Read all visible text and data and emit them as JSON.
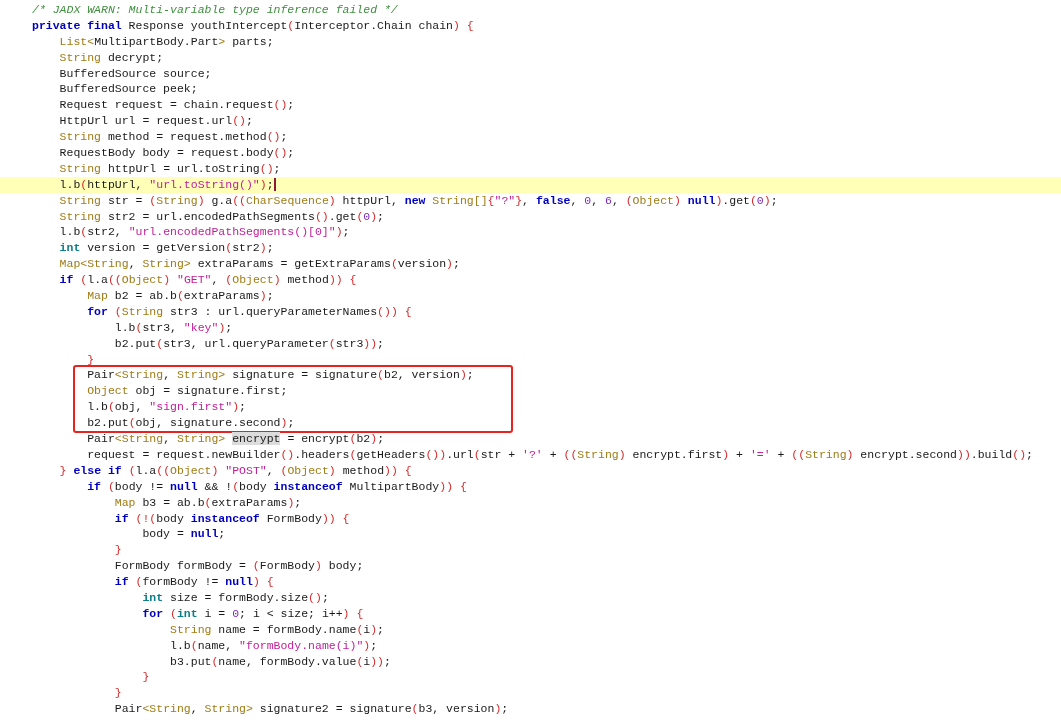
{
  "editor": {
    "blocks": [
      {
        "kind": "plain",
        "lines": [
          {
            "current": false,
            "tokens": [
              {
                "text": "/* JADX WARN: Multi-variable type inference failed */",
                "kind": "comment"
              }
            ]
          },
          {
            "current": false,
            "tokens": [
              {
                "text": "private final",
                "kind": "keyword"
              },
              {
                "text": " Response youthIntercept",
                "kind": "plain"
              },
              {
                "text": "(",
                "kind": "paren"
              },
              {
                "text": "Interceptor.Chain chain",
                "kind": "plain"
              },
              {
                "text": ") {",
                "kind": "paren"
              }
            ]
          },
          {
            "current": false,
            "tokens": [
              {
                "text": "    List<",
                "kind": "type"
              },
              {
                "text": "MultipartBody.Part",
                "kind": "plain"
              },
              {
                "text": ">",
                "kind": "type"
              },
              {
                "text": " parts;",
                "kind": "plain"
              }
            ]
          },
          {
            "current": false,
            "tokens": [
              {
                "text": "    String",
                "kind": "type"
              },
              {
                "text": " decrypt;",
                "kind": "plain"
              }
            ]
          },
          {
            "current": false,
            "tokens": [
              {
                "text": "    BufferedSource source;",
                "kind": "plain"
              }
            ]
          },
          {
            "current": false,
            "tokens": [
              {
                "text": "    BufferedSource peek;",
                "kind": "plain"
              }
            ]
          },
          {
            "current": false,
            "tokens": [
              {
                "text": "    Request request = chain.request",
                "kind": "plain"
              },
              {
                "text": "()",
                "kind": "paren"
              },
              {
                "text": ";",
                "kind": "plain"
              }
            ]
          },
          {
            "current": false,
            "tokens": [
              {
                "text": "    HttpUrl url = request.url",
                "kind": "plain"
              },
              {
                "text": "()",
                "kind": "paren"
              },
              {
                "text": ";",
                "kind": "plain"
              }
            ]
          },
          {
            "current": false,
            "tokens": [
              {
                "text": "    String",
                "kind": "type"
              },
              {
                "text": " method = request.method",
                "kind": "plain"
              },
              {
                "text": "()",
                "kind": "paren"
              },
              {
                "text": ";",
                "kind": "plain"
              }
            ]
          },
          {
            "current": false,
            "tokens": [
              {
                "text": "    RequestBody body = request.body",
                "kind": "plain"
              },
              {
                "text": "()",
                "kind": "paren"
              },
              {
                "text": ";",
                "kind": "plain"
              }
            ]
          },
          {
            "current": false,
            "tokens": [
              {
                "text": "    String",
                "kind": "type"
              },
              {
                "text": " httpUrl = url.toString",
                "kind": "plain"
              },
              {
                "text": "()",
                "kind": "paren"
              },
              {
                "text": ";",
                "kind": "plain"
              }
            ]
          },
          {
            "current": true,
            "tokens": [
              {
                "text": "    l.b",
                "kind": "plain"
              },
              {
                "text": "(",
                "kind": "paren"
              },
              {
                "text": "httpUrl, ",
                "kind": "plain"
              },
              {
                "text": "\"url.toString()\"",
                "kind": "string"
              },
              {
                "text": ")",
                "kind": "paren"
              },
              {
                "text": ";",
                "kind": "plain"
              }
            ]
          },
          {
            "current": false,
            "tokens": [
              {
                "text": "    String",
                "kind": "type"
              },
              {
                "text": " str = ",
                "kind": "plain"
              },
              {
                "text": "(",
                "kind": "paren"
              },
              {
                "text": "String",
                "kind": "type"
              },
              {
                "text": ")",
                "kind": "paren"
              },
              {
                "text": " g.a",
                "kind": "plain"
              },
              {
                "text": "((",
                "kind": "paren"
              },
              {
                "text": "CharSequence",
                "kind": "type"
              },
              {
                "text": ")",
                "kind": "paren"
              },
              {
                "text": " httpUrl, ",
                "kind": "plain"
              },
              {
                "text": "new",
                "kind": "keyword"
              },
              {
                "text": " String[]",
                "kind": "type"
              },
              {
                "text": "{",
                "kind": "paren"
              },
              {
                "text": "\"?\"",
                "kind": "string"
              },
              {
                "text": "}",
                "kind": "paren"
              },
              {
                "text": ", ",
                "kind": "plain"
              },
              {
                "text": "false",
                "kind": "keyword"
              },
              {
                "text": ", ",
                "kind": "plain"
              },
              {
                "text": "0",
                "kind": "number"
              },
              {
                "text": ", ",
                "kind": "plain"
              },
              {
                "text": "6",
                "kind": "number"
              },
              {
                "text": ", ",
                "kind": "plain"
              },
              {
                "text": "(",
                "kind": "paren"
              },
              {
                "text": "Object",
                "kind": "type"
              },
              {
                "text": ")",
                "kind": "paren"
              },
              {
                "text": " null",
                "kind": "keyword"
              },
              {
                "text": ")",
                "kind": "paren"
              },
              {
                "text": ".get",
                "kind": "plain"
              },
              {
                "text": "(",
                "kind": "paren"
              },
              {
                "text": "0",
                "kind": "number"
              },
              {
                "text": ")",
                "kind": "paren"
              },
              {
                "text": ";",
                "kind": "plain"
              }
            ]
          },
          {
            "current": false,
            "tokens": [
              {
                "text": "    String",
                "kind": "type"
              },
              {
                "text": " str2 = url.encodedPathSegments",
                "kind": "plain"
              },
              {
                "text": "()",
                "kind": "paren"
              },
              {
                "text": ".get",
                "kind": "plain"
              },
              {
                "text": "(",
                "kind": "paren"
              },
              {
                "text": "0",
                "kind": "number"
              },
              {
                "text": ")",
                "kind": "paren"
              },
              {
                "text": ";",
                "kind": "plain"
              }
            ]
          },
          {
            "current": false,
            "tokens": [
              {
                "text": "    l.b",
                "kind": "plain"
              },
              {
                "text": "(",
                "kind": "paren"
              },
              {
                "text": "str2, ",
                "kind": "plain"
              },
              {
                "text": "\"url.encodedPathSegments()[0]\"",
                "kind": "string"
              },
              {
                "text": ")",
                "kind": "paren"
              },
              {
                "text": ";",
                "kind": "plain"
              }
            ]
          },
          {
            "current": false,
            "tokens": [
              {
                "text": "    int",
                "kind": "primitive"
              },
              {
                "text": " version = getVersion",
                "kind": "plain"
              },
              {
                "text": "(",
                "kind": "paren"
              },
              {
                "text": "str2",
                "kind": "plain"
              },
              {
                "text": ")",
                "kind": "paren"
              },
              {
                "text": ";",
                "kind": "plain"
              }
            ]
          },
          {
            "current": false,
            "tokens": [
              {
                "text": "    Map<String",
                "kind": "type"
              },
              {
                "text": ", ",
                "kind": "plain"
              },
              {
                "text": "String>",
                "kind": "type"
              },
              {
                "text": " extraParams = getExtraParams",
                "kind": "plain"
              },
              {
                "text": "(",
                "kind": "paren"
              },
              {
                "text": "version",
                "kind": "plain"
              },
              {
                "text": ")",
                "kind": "paren"
              },
              {
                "text": ";",
                "kind": "plain"
              }
            ]
          },
          {
            "current": false,
            "tokens": [
              {
                "text": "    if",
                "kind": "keyword"
              },
              {
                "text": " (",
                "kind": "paren"
              },
              {
                "text": "l.a",
                "kind": "plain"
              },
              {
                "text": "((",
                "kind": "paren"
              },
              {
                "text": "Object",
                "kind": "type"
              },
              {
                "text": ")",
                "kind": "paren"
              },
              {
                "text": " \"GET\"",
                "kind": "string"
              },
              {
                "text": ", ",
                "kind": "plain"
              },
              {
                "text": "(",
                "kind": "paren"
              },
              {
                "text": "Object",
                "kind": "type"
              },
              {
                "text": ")",
                "kind": "paren"
              },
              {
                "text": " method",
                "kind": "plain"
              },
              {
                "text": ")) {",
                "kind": "paren"
              }
            ]
          },
          {
            "current": false,
            "tokens": [
              {
                "text": "        Map",
                "kind": "type"
              },
              {
                "text": " b2 = ab.b",
                "kind": "plain"
              },
              {
                "text": "(",
                "kind": "paren"
              },
              {
                "text": "extraParams",
                "kind": "plain"
              },
              {
                "text": ")",
                "kind": "paren"
              },
              {
                "text": ";",
                "kind": "plain"
              }
            ]
          },
          {
            "current": false,
            "tokens": [
              {
                "text": "        for",
                "kind": "keyword"
              },
              {
                "text": " (",
                "kind": "paren"
              },
              {
                "text": "String",
                "kind": "type"
              },
              {
                "text": " str3 : url.queryParameterNames",
                "kind": "plain"
              },
              {
                "text": "()) {",
                "kind": "paren"
              }
            ]
          },
          {
            "current": false,
            "tokens": [
              {
                "text": "            l.b",
                "kind": "plain"
              },
              {
                "text": "(",
                "kind": "paren"
              },
              {
                "text": "str3, ",
                "kind": "plain"
              },
              {
                "text": "\"key\"",
                "kind": "string"
              },
              {
                "text": ")",
                "kind": "paren"
              },
              {
                "text": ";",
                "kind": "plain"
              }
            ]
          },
          {
            "current": false,
            "tokens": [
              {
                "text": "            b2.put",
                "kind": "plain"
              },
              {
                "text": "(",
                "kind": "paren"
              },
              {
                "text": "str3, url.queryParameter",
                "kind": "plain"
              },
              {
                "text": "(",
                "kind": "paren"
              },
              {
                "text": "str3",
                "kind": "plain"
              },
              {
                "text": "))",
                "kind": "paren"
              },
              {
                "text": ";",
                "kind": "plain"
              }
            ]
          },
          {
            "current": false,
            "tokens": [
              {
                "text": "        }",
                "kind": "paren"
              }
            ]
          }
        ]
      },
      {
        "kind": "annotated",
        "lines": [
          {
            "current": false,
            "tokens": [
              {
                "text": "        Pair",
                "kind": "plain"
              },
              {
                "text": "<String",
                "kind": "type"
              },
              {
                "text": ", ",
                "kind": "plain"
              },
              {
                "text": "String>",
                "kind": "type"
              },
              {
                "text": " signature = signature",
                "kind": "plain"
              },
              {
                "text": "(",
                "kind": "paren"
              },
              {
                "text": "b2, version",
                "kind": "plain"
              },
              {
                "text": ")",
                "kind": "paren"
              },
              {
                "text": ";",
                "kind": "plain"
              }
            ]
          },
          {
            "current": false,
            "tokens": [
              {
                "text": "        Object",
                "kind": "type"
              },
              {
                "text": " obj = signature.first;",
                "kind": "plain"
              }
            ]
          },
          {
            "current": false,
            "tokens": [
              {
                "text": "        l.b",
                "kind": "plain"
              },
              {
                "text": "(",
                "kind": "paren"
              },
              {
                "text": "obj, ",
                "kind": "plain"
              },
              {
                "text": "\"sign.first\"",
                "kind": "string"
              },
              {
                "text": ")",
                "kind": "paren"
              },
              {
                "text": ";",
                "kind": "plain"
              }
            ]
          },
          {
            "current": false,
            "tokens": [
              {
                "text": "        b2.put",
                "kind": "plain"
              },
              {
                "text": "(",
                "kind": "paren"
              },
              {
                "text": "obj, signature.second",
                "kind": "plain"
              },
              {
                "text": ")",
                "kind": "paren"
              },
              {
                "text": ";",
                "kind": "plain"
              }
            ]
          }
        ]
      },
      {
        "kind": "plain",
        "lines": [
          {
            "current": false,
            "tokens": [
              {
                "text": "        Pair",
                "kind": "plain"
              },
              {
                "text": "<String",
                "kind": "type"
              },
              {
                "text": ", ",
                "kind": "plain"
              },
              {
                "text": "String> ",
                "kind": "type"
              },
              {
                "text": "encrypt",
                "kind": "match"
              },
              {
                "text": " = encrypt",
                "kind": "plain"
              },
              {
                "text": "(",
                "kind": "paren"
              },
              {
                "text": "b2",
                "kind": "plain"
              },
              {
                "text": ")",
                "kind": "paren"
              },
              {
                "text": ";",
                "kind": "plain"
              }
            ]
          },
          {
            "current": false,
            "tokens": [
              {
                "text": "        request = request.newBuilder",
                "kind": "plain"
              },
              {
                "text": "()",
                "kind": "paren"
              },
              {
                "text": ".headers",
                "kind": "plain"
              },
              {
                "text": "(",
                "kind": "paren"
              },
              {
                "text": "getHeaders",
                "kind": "plain"
              },
              {
                "text": "())",
                "kind": "paren"
              },
              {
                "text": ".url",
                "kind": "plain"
              },
              {
                "text": "(",
                "kind": "paren"
              },
              {
                "text": "str + ",
                "kind": "plain"
              },
              {
                "text": "'?'",
                "kind": "string"
              },
              {
                "text": " + ",
                "kind": "plain"
              },
              {
                "text": "((",
                "kind": "paren"
              },
              {
                "text": "String",
                "kind": "type"
              },
              {
                "text": ")",
                "kind": "paren"
              },
              {
                "text": " encrypt.first",
                "kind": "plain"
              },
              {
                "text": ")",
                "kind": "paren"
              },
              {
                "text": " + ",
                "kind": "plain"
              },
              {
                "text": "'='",
                "kind": "string"
              },
              {
                "text": " + ",
                "kind": "plain"
              },
              {
                "text": "((",
                "kind": "paren"
              },
              {
                "text": "String",
                "kind": "type"
              },
              {
                "text": ")",
                "kind": "paren"
              },
              {
                "text": " encrypt.second",
                "kind": "plain"
              },
              {
                "text": "))",
                "kind": "paren"
              },
              {
                "text": ".build",
                "kind": "plain"
              },
              {
                "text": "()",
                "kind": "paren"
              },
              {
                "text": ";",
                "kind": "plain"
              }
            ]
          },
          {
            "current": false,
            "tokens": [
              {
                "text": "    } ",
                "kind": "paren"
              },
              {
                "text": "else if",
                "kind": "keyword"
              },
              {
                "text": " (",
                "kind": "paren"
              },
              {
                "text": "l.a",
                "kind": "plain"
              },
              {
                "text": "((",
                "kind": "paren"
              },
              {
                "text": "Object",
                "kind": "type"
              },
              {
                "text": ")",
                "kind": "paren"
              },
              {
                "text": " \"POST\"",
                "kind": "string"
              },
              {
                "text": ", ",
                "kind": "plain"
              },
              {
                "text": "(",
                "kind": "paren"
              },
              {
                "text": "Object",
                "kind": "type"
              },
              {
                "text": ")",
                "kind": "paren"
              },
              {
                "text": " method",
                "kind": "plain"
              },
              {
                "text": ")) {",
                "kind": "paren"
              }
            ]
          },
          {
            "current": false,
            "tokens": [
              {
                "text": "        if",
                "kind": "keyword"
              },
              {
                "text": " (",
                "kind": "paren"
              },
              {
                "text": "body != ",
                "kind": "plain"
              },
              {
                "text": "null",
                "kind": "keyword"
              },
              {
                "text": " && !",
                "kind": "plain"
              },
              {
                "text": "(",
                "kind": "paren"
              },
              {
                "text": "body ",
                "kind": "plain"
              },
              {
                "text": "instanceof",
                "kind": "keyword"
              },
              {
                "text": " MultipartBody",
                "kind": "plain"
              },
              {
                "text": ")) {",
                "kind": "paren"
              }
            ]
          },
          {
            "current": false,
            "tokens": [
              {
                "text": "            Map",
                "kind": "type"
              },
              {
                "text": " b3 = ab.b",
                "kind": "plain"
              },
              {
                "text": "(",
                "kind": "paren"
              },
              {
                "text": "extraParams",
                "kind": "plain"
              },
              {
                "text": ")",
                "kind": "paren"
              },
              {
                "text": ";",
                "kind": "plain"
              }
            ]
          },
          {
            "current": false,
            "tokens": [
              {
                "text": "            if",
                "kind": "keyword"
              },
              {
                "text": " (!(",
                "kind": "paren"
              },
              {
                "text": "body ",
                "kind": "plain"
              },
              {
                "text": "instanceof",
                "kind": "keyword"
              },
              {
                "text": " FormBody",
                "kind": "plain"
              },
              {
                "text": ")) {",
                "kind": "paren"
              }
            ]
          },
          {
            "current": false,
            "tokens": [
              {
                "text": "                body = ",
                "kind": "plain"
              },
              {
                "text": "null",
                "kind": "keyword"
              },
              {
                "text": ";",
                "kind": "plain"
              }
            ]
          },
          {
            "current": false,
            "tokens": [
              {
                "text": "            }",
                "kind": "paren"
              }
            ]
          },
          {
            "current": false,
            "tokens": [
              {
                "text": "            FormBody formBody = ",
                "kind": "plain"
              },
              {
                "text": "(",
                "kind": "paren"
              },
              {
                "text": "FormBody",
                "kind": "plain"
              },
              {
                "text": ")",
                "kind": "paren"
              },
              {
                "text": " body;",
                "kind": "plain"
              }
            ]
          },
          {
            "current": false,
            "tokens": [
              {
                "text": "            if",
                "kind": "keyword"
              },
              {
                "text": " (",
                "kind": "paren"
              },
              {
                "text": "formBody != ",
                "kind": "plain"
              },
              {
                "text": "null",
                "kind": "keyword"
              },
              {
                "text": ") {",
                "kind": "paren"
              }
            ]
          },
          {
            "current": false,
            "tokens": [
              {
                "text": "                int",
                "kind": "primitive"
              },
              {
                "text": " size = formBody.size",
                "kind": "plain"
              },
              {
                "text": "()",
                "kind": "paren"
              },
              {
                "text": ";",
                "kind": "plain"
              }
            ]
          },
          {
            "current": false,
            "tokens": [
              {
                "text": "                for",
                "kind": "keyword"
              },
              {
                "text": " (",
                "kind": "paren"
              },
              {
                "text": "int",
                "kind": "primitive"
              },
              {
                "text": " i = ",
                "kind": "plain"
              },
              {
                "text": "0",
                "kind": "number"
              },
              {
                "text": "; i < size; i++",
                "kind": "plain"
              },
              {
                "text": ") {",
                "kind": "paren"
              }
            ]
          },
          {
            "current": false,
            "tokens": [
              {
                "text": "                    String",
                "kind": "type"
              },
              {
                "text": " name = formBody.name",
                "kind": "plain"
              },
              {
                "text": "(",
                "kind": "paren"
              },
              {
                "text": "i",
                "kind": "plain"
              },
              {
                "text": ")",
                "kind": "paren"
              },
              {
                "text": ";",
                "kind": "plain"
              }
            ]
          },
          {
            "current": false,
            "tokens": [
              {
                "text": "                    l.b",
                "kind": "plain"
              },
              {
                "text": "(",
                "kind": "paren"
              },
              {
                "text": "name, ",
                "kind": "plain"
              },
              {
                "text": "\"formBody.name(i)\"",
                "kind": "string"
              },
              {
                "text": ")",
                "kind": "paren"
              },
              {
                "text": ";",
                "kind": "plain"
              }
            ]
          },
          {
            "current": false,
            "tokens": [
              {
                "text": "                    b3.put",
                "kind": "plain"
              },
              {
                "text": "(",
                "kind": "paren"
              },
              {
                "text": "name, formBody.value",
                "kind": "plain"
              },
              {
                "text": "(",
                "kind": "paren"
              },
              {
                "text": "i",
                "kind": "plain"
              },
              {
                "text": "))",
                "kind": "paren"
              },
              {
                "text": ";",
                "kind": "plain"
              }
            ]
          },
          {
            "current": false,
            "tokens": [
              {
                "text": "                }",
                "kind": "paren"
              }
            ]
          },
          {
            "current": false,
            "tokens": [
              {
                "text": "            }",
                "kind": "paren"
              }
            ]
          },
          {
            "current": false,
            "tokens": [
              {
                "text": "            Pair",
                "kind": "plain"
              },
              {
                "text": "<String",
                "kind": "type"
              },
              {
                "text": ", ",
                "kind": "plain"
              },
              {
                "text": "String>",
                "kind": "type"
              },
              {
                "text": " signature2 = signature",
                "kind": "plain"
              },
              {
                "text": "(",
                "kind": "paren"
              },
              {
                "text": "b3, version",
                "kind": "plain"
              },
              {
                "text": ")",
                "kind": "paren"
              },
              {
                "text": ";",
                "kind": "plain"
              }
            ]
          }
        ]
      }
    ]
  }
}
